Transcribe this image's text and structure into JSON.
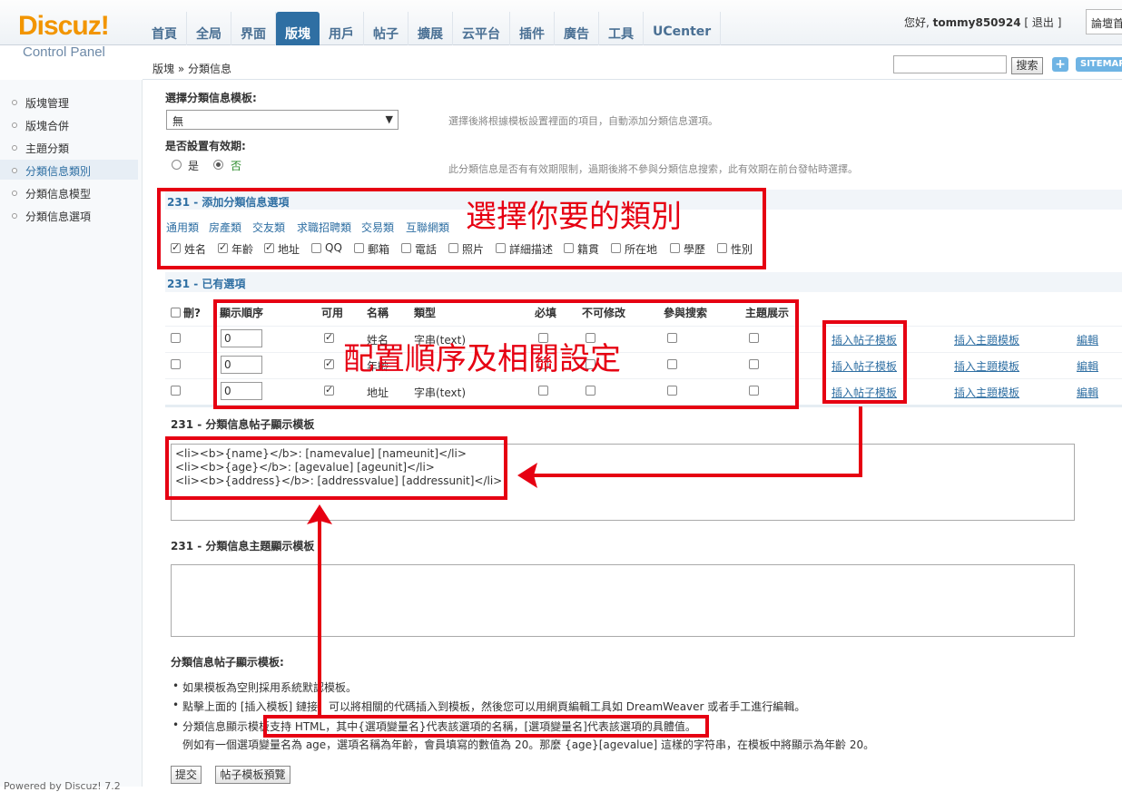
{
  "header": {
    "logo": "Discuz!",
    "logo_sub": "Control Panel",
    "nav": [
      "首頁",
      "全局",
      "界面",
      "版塊",
      "用戶",
      "帖子",
      "擴展",
      "云平台",
      "插件",
      "廣告",
      "工具",
      "UCenter"
    ],
    "active_nav": "版塊",
    "greeting_prefix": "您好,",
    "username": "tommy850924",
    "logout": "[ 退出 ]",
    "switch_label": "論壇首"
  },
  "topbar": {
    "breadcrumb": "版塊 » 分類信息",
    "search_button": "搜索",
    "plus": "+",
    "sitemap": "SITEMAP"
  },
  "sidebar": {
    "items": [
      "版塊管理",
      "版塊合併",
      "主題分類",
      "分類信息類別",
      "分類信息模型",
      "分類信息選項"
    ],
    "active_index": 3,
    "powered": "Powered by Discuz! 7.2"
  },
  "form": {
    "template_label": "選擇分類信息模板:",
    "template_value": "無",
    "template_tip": "選擇後將根據模板設置裡面的項目，自動添加分類信息選項。",
    "expiry_label": "是否設置有效期:",
    "expiry_yes": "是",
    "expiry_no": "否",
    "expiry_tip": "此分類信息是否有有效期限制，過期後將不參與分類信息搜索，此有效期在前台發帖時選擇。"
  },
  "add_section": {
    "title": "231 - 添加分類信息選項",
    "categories": [
      "通用類",
      "房產類",
      "交友類",
      "求職招聘類",
      "交易類",
      "互聯網類"
    ],
    "options": [
      {
        "label": "姓名",
        "checked": true
      },
      {
        "label": "年齡",
        "checked": true
      },
      {
        "label": "地址",
        "checked": true
      },
      {
        "label": "QQ",
        "checked": false
      },
      {
        "label": "郵箱",
        "checked": false
      },
      {
        "label": "電話",
        "checked": false
      },
      {
        "label": "照片",
        "checked": false
      },
      {
        "label": "詳細描述",
        "checked": false
      },
      {
        "label": "籍貫",
        "checked": false
      },
      {
        "label": "所在地",
        "checked": false
      },
      {
        "label": "學歷",
        "checked": false
      },
      {
        "label": "性別",
        "checked": false
      }
    ]
  },
  "existing": {
    "title": "231 - 已有選項",
    "headers": [
      "刪?",
      "顯示順序",
      "可用",
      "名稱",
      "類型",
      "必填",
      "不可修改",
      "參與搜索",
      "主題展示"
    ],
    "rows": [
      {
        "order": "0",
        "name": "姓名",
        "type": "字串(text)",
        "enabled": true
      },
      {
        "order": "0",
        "name": "年齡",
        "type": "",
        "enabled": true
      },
      {
        "order": "0",
        "name": "地址",
        "type": "字串(text)",
        "enabled": true
      }
    ],
    "insert_post": "插入帖子模板",
    "insert_thread": "插入主題模板",
    "edit": "編輯"
  },
  "post_template": {
    "title": "231 - 分類信息帖子顯示模板",
    "lines": [
      "<li><b>{name}</b>: [namevalue] [nameunit]</li>",
      "<li><b>{age}</b>: [agevalue] [ageunit]</li>",
      "<li><b>{address}</b>: [addressvalue] [addressunit]</li>"
    ]
  },
  "thread_template": {
    "title": "231 - 分類信息主題顯示模板"
  },
  "help": {
    "title": "分類信息帖子顯示模板:",
    "bullets": [
      "如果模板為空則採用系統默認模板。",
      "點擊上面的 [插入模板] 鏈接，可以將相關的代碼插入到模板，然後您可以用網頁編輯工具如 DreamWeaver 或者手工進行編輯。",
      "分類信息顯示模板支持 HTML，其中{選項變量名}代表該選項的名稱，[選項變量名]代表該選項的具體值。"
    ],
    "example": "例如有一個選項變量名為 age，選項名稱為年齡，會員填寫的數值為 20。那麼 {age}[agevalue] 這樣的字符串，在模板中將顯示為年齡 20。"
  },
  "buttons": {
    "submit": "提交",
    "preview": "帖子模板預覽"
  },
  "annotations": {
    "choose_category": "選擇你要的類別",
    "configure": "配置順序及相關設定",
    "color": "#e60012"
  }
}
